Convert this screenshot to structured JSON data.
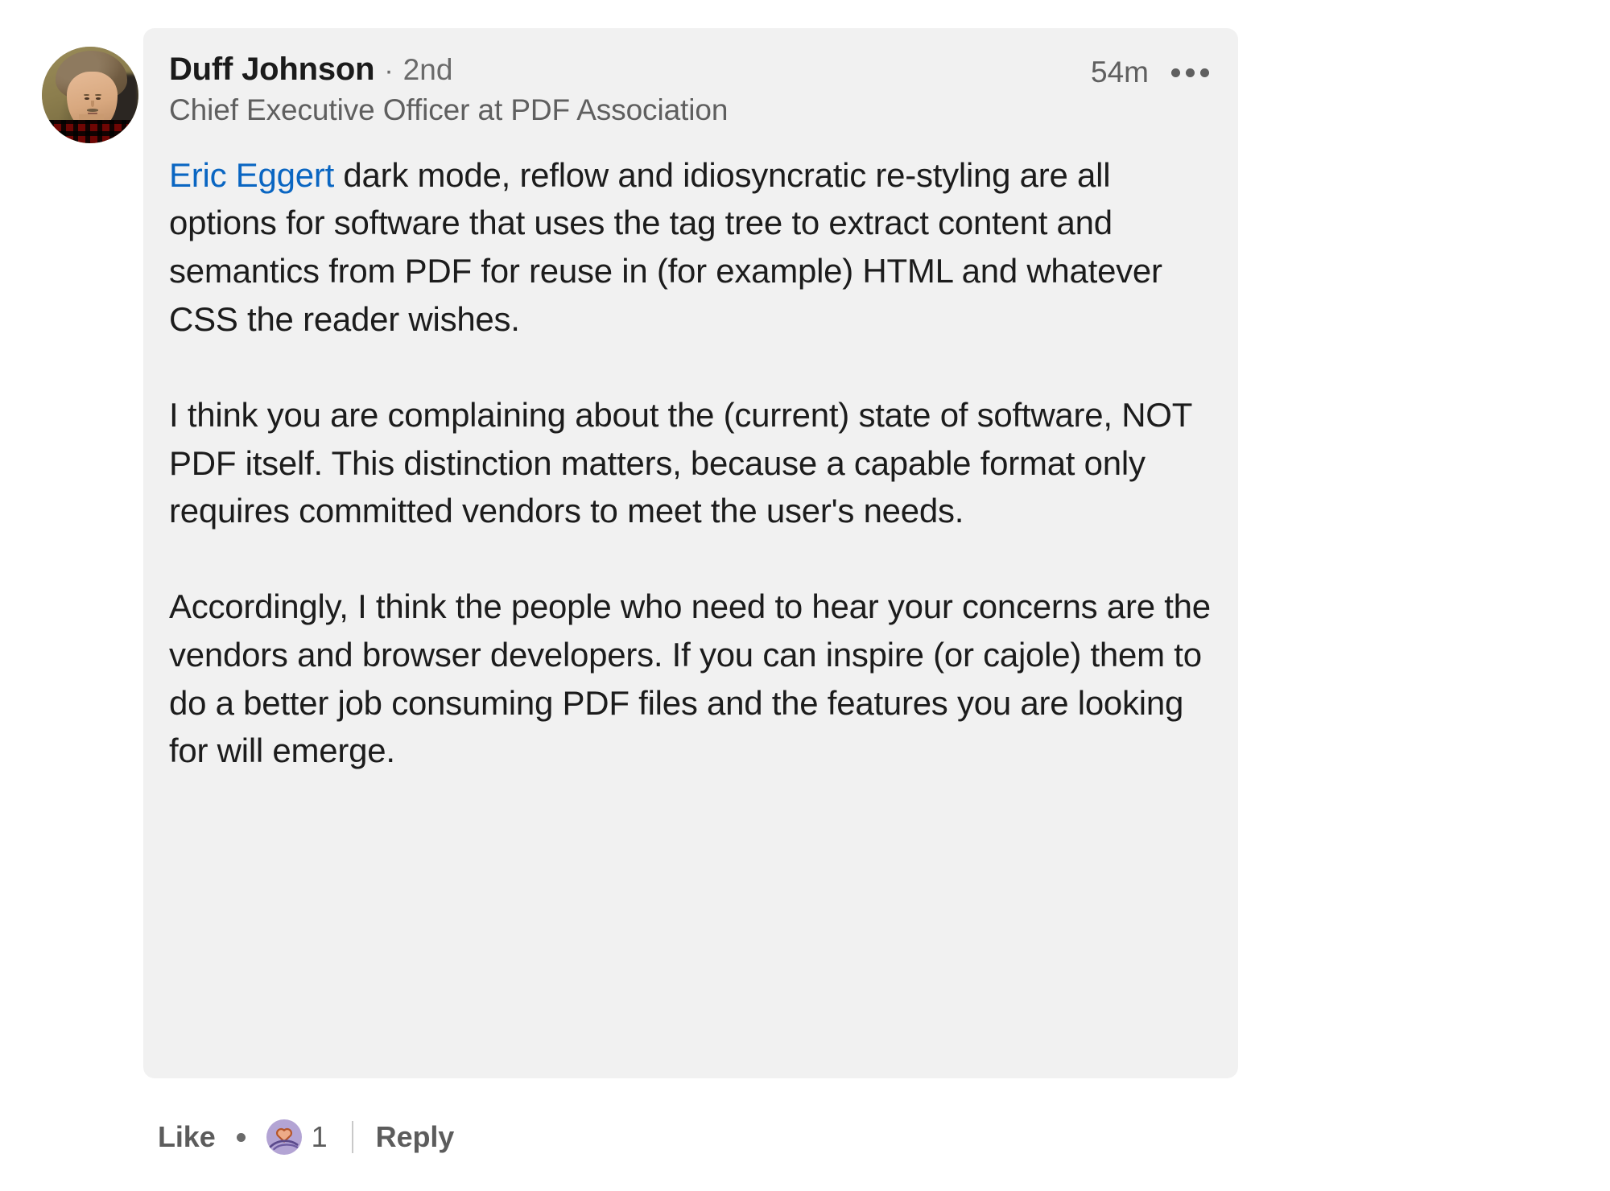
{
  "comment": {
    "author": {
      "name": "Duff Johnson",
      "separator": "·",
      "degree": "2nd",
      "headline": "Chief Executive Officer at PDF Association",
      "avatar_alt": "Duff Johnson profile photo"
    },
    "timestamp": "54m",
    "more_menu_label": "•••",
    "mention": "Eric Eggert",
    "paragraphs": [
      " dark mode, reflow and idiosyncratic re-styling are all options for software that uses the tag tree to extract content and semantics from PDF for reuse in (for example) HTML and whatever CSS the reader wishes.",
      "I think you are complaining about the (current) state of software, NOT PDF itself. This distinction matters, because a capable format only requires committed vendors to meet the user's needs.",
      "Accordingly, I think the people who need to hear your concerns are the vendors and browser developers. If you can inspire (or cajole) them to do a better job consuming PDF files and the features you are looking for will emerge."
    ]
  },
  "actions": {
    "like_label": "Like",
    "separator": "·",
    "reaction_name": "support-reaction-icon",
    "reaction_count": "1",
    "reply_label": "Reply"
  },
  "colors": {
    "card_background": "#f1f1f1",
    "page_background": "#ffffff",
    "mention_link": "#0a66c2",
    "body_text": "#1c1c1c",
    "muted_text": "#5f5f5f",
    "reaction_circle": "#b3a4d4",
    "reaction_heart": "#e8a383",
    "reaction_heart_outline": "#b4552a"
  }
}
